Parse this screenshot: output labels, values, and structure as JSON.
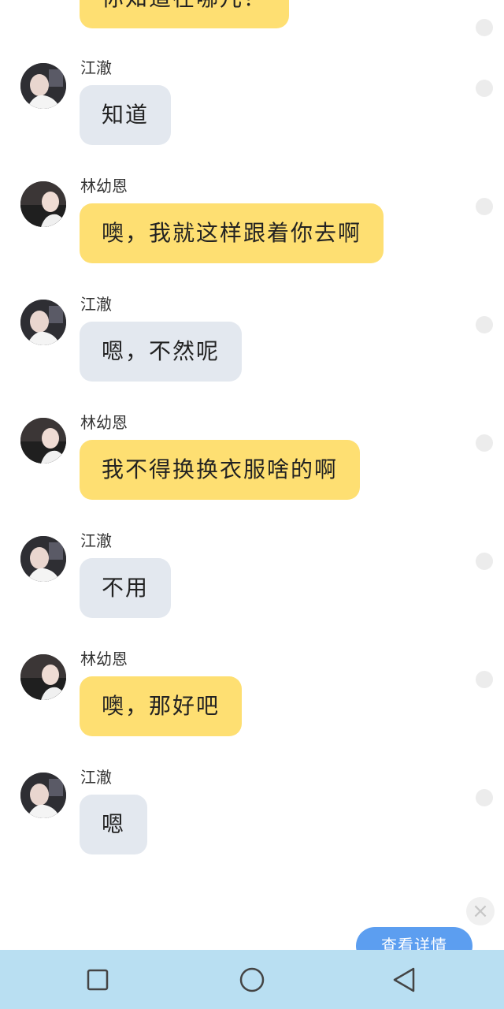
{
  "top_partial_message": {
    "text": "你知道在哪儿？"
  },
  "messages": [
    {
      "sender": "江澈",
      "text": "知道",
      "side_color": "gray"
    },
    {
      "sender": "林幼恩",
      "text": "噢，我就这样跟着你去啊",
      "side_color": "yellow"
    },
    {
      "sender": "江澈",
      "text": "嗯，不然呢",
      "side_color": "gray"
    },
    {
      "sender": "林幼恩",
      "text": "我不得换换衣服啥的啊",
      "side_color": "yellow"
    },
    {
      "sender": "江澈",
      "text": "不用",
      "side_color": "gray"
    },
    {
      "sender": "林幼恩",
      "text": "噢，那好吧",
      "side_color": "yellow"
    },
    {
      "sender": "江澈",
      "text": "嗯",
      "side_color": "gray"
    }
  ],
  "floating": {
    "detail_button": "查看详情",
    "close_icon": "×"
  },
  "colors": {
    "yellow_bubble": "#fedf72",
    "gray_bubble": "#e3e8ef",
    "navbar": "#b9dff2",
    "detail_button": "#5c9ef0"
  },
  "nav": {
    "icons": [
      "square-recent-icon",
      "circle-home-icon",
      "triangle-back-icon"
    ]
  }
}
